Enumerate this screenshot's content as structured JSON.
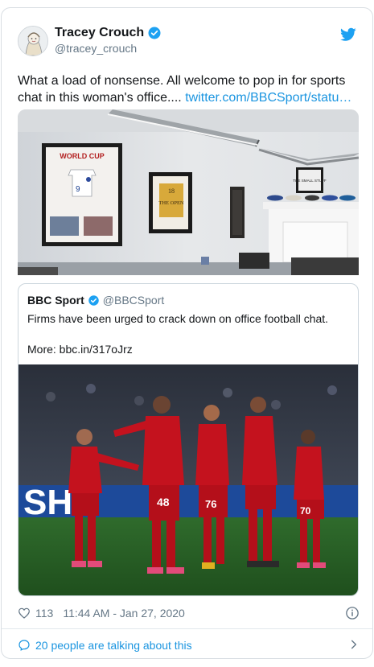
{
  "author": {
    "name": "Tracey Crouch",
    "handle": "@tracey_crouch"
  },
  "tweet": {
    "text": "What a load of nonsense. All welcome to pop in for sports chat in this woman's office.... ",
    "link": "twitter.com/BBCSport/statu…"
  },
  "photo": {
    "frame1_text": "WORLD CUP",
    "frame2_text": "THE OPEN",
    "sign_text": "THE SMALL STUFF"
  },
  "quoted": {
    "name": "BBC Sport",
    "handle": "@BBCSport",
    "text": "Firms have been urged to crack down on office football chat.",
    "more": "More: bbc.in/317oJrz",
    "shirt_numbers": [
      "48",
      "76",
      "70"
    ]
  },
  "footer": {
    "likes": "113",
    "timestamp": "11:44 AM - Jan 27, 2020"
  },
  "talking": {
    "label": "20 people are talking about this"
  },
  "colors": {
    "link": "#1b95e0",
    "verified": "#1da1f2",
    "muted": "#657786"
  },
  "icons": [
    "avatar",
    "verified-icon",
    "twitter-bird-icon",
    "heart-icon",
    "info-icon",
    "comment-bubble-icon",
    "chevron-right-icon"
  ]
}
